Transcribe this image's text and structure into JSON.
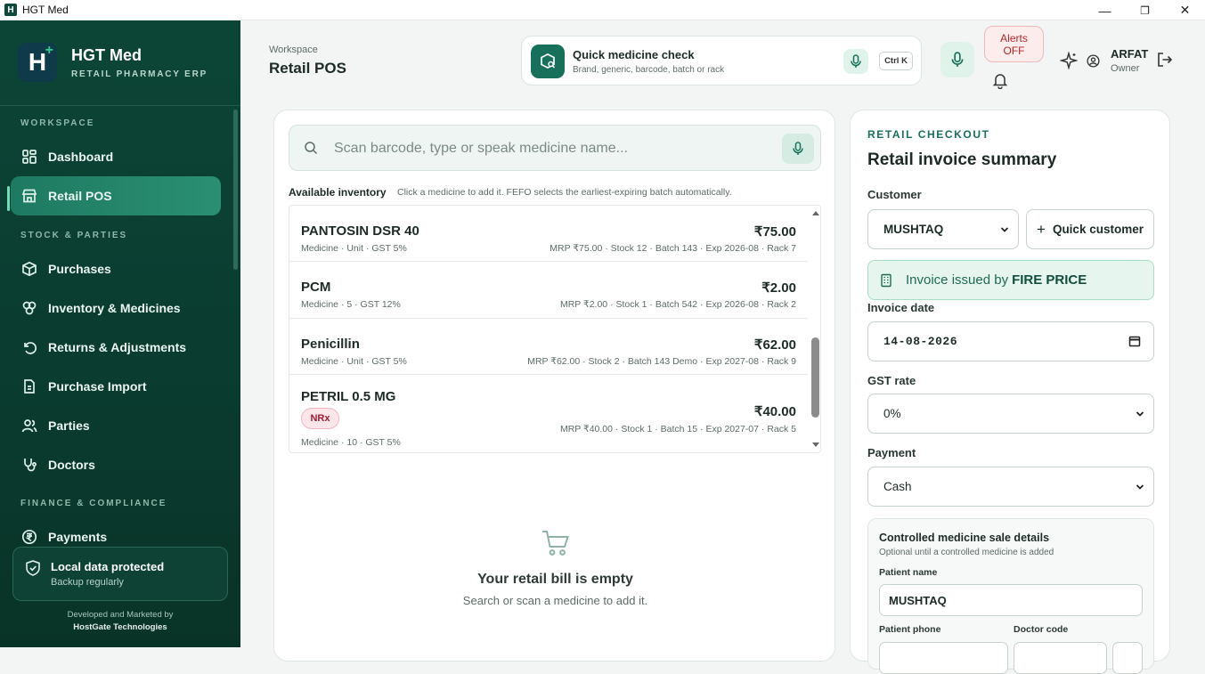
{
  "window": {
    "title": "HGT Med",
    "minimize": "—",
    "maximize": "❐",
    "close": "✕"
  },
  "brand": {
    "logo_letter": "H",
    "logo_plus": "+",
    "name": "HGT Med",
    "subtitle": "RETAIL PHARMACY ERP"
  },
  "sidebar": {
    "sections": {
      "workspace": "WORKSPACE",
      "stock": "STOCK & PARTIES",
      "finance": "FINANCE & COMPLIANCE"
    },
    "items": [
      {
        "label": "Dashboard",
        "icon": "dashboard-icon"
      },
      {
        "label": "Retail POS",
        "icon": "store-icon",
        "active": true
      },
      {
        "label": "Purchases",
        "icon": "box-icon"
      },
      {
        "label": "Inventory & Medicines",
        "icon": "pills-icon"
      },
      {
        "label": "Returns & Adjustments",
        "icon": "undo-icon"
      },
      {
        "label": "Purchase Import",
        "icon": "import-icon"
      },
      {
        "label": "Parties",
        "icon": "users-icon"
      },
      {
        "label": "Doctors",
        "icon": "stethoscope-icon"
      },
      {
        "label": "Payments",
        "icon": "rupee-icon"
      }
    ],
    "protect": {
      "title": "Local data protected",
      "subtitle": "Backup regularly"
    },
    "credit": {
      "line1": "Developed and Marketed by",
      "line2": "HostGate Technologies"
    }
  },
  "header": {
    "workspace_label": "Workspace",
    "workspace_title": "Retail POS",
    "quick_check": {
      "title": "Quick medicine check",
      "subtitle": "Brand, generic, barcode, batch or rack",
      "shortcut": "Ctrl K"
    },
    "alerts": {
      "line1": "Alerts",
      "line2": "OFF"
    },
    "user": {
      "name": "ARFAT",
      "role": "Owner"
    }
  },
  "pos": {
    "search_placeholder": "Scan barcode, type or speak medicine name...",
    "inventory_label": "Available inventory",
    "inventory_hint": "Click a medicine to add it. FEFO selects the earliest-expiring batch automatically.",
    "items": [
      {
        "name": "PANTOSIN DSR 40",
        "meta": "Medicine · Unit · GST 5%",
        "price": "₹75.00",
        "detail": "MRP ₹75.00 · Stock 12 · Batch 143 · Exp 2026-08 · Rack 7",
        "badge": ""
      },
      {
        "name": "PCM",
        "meta": "Medicine · 5 · GST 12%",
        "price": "₹2.00",
        "detail": "MRP ₹2.00 · Stock 1 · Batch 542 · Exp 2026-08 · Rack 2",
        "badge": ""
      },
      {
        "name": "Penicillin",
        "meta": "Medicine · Unit · GST 5%",
        "price": "₹62.00",
        "detail": "MRP ₹62.00 · Stock 2 · Batch 143 Demo · Exp 2027-08 · Rack 9",
        "badge": ""
      },
      {
        "name": "PETRIL 0.5 MG",
        "meta": "Medicine · 10 · GST 5%",
        "price": "₹40.00",
        "detail": "MRP ₹40.00 · Stock 1 · Batch 15 · Exp 2027-07 · Rack 5",
        "badge": "NRx"
      }
    ],
    "empty_title": "Your retail bill is empty",
    "empty_subtitle": "Search or scan a medicine to add it."
  },
  "checkout": {
    "kicker": "RETAIL CHECKOUT",
    "title": "Retail invoice summary",
    "customer_label": "Customer",
    "customer_value": "MUSHTAQ",
    "quick_customer": "Quick customer",
    "issued_prefix": "Invoice issued by",
    "issued_by": "FIRE PRICE",
    "date_label": "Invoice date",
    "date_value": "14-08-2026",
    "gst_label": "GST rate",
    "gst_value": "0%",
    "payment_label": "Payment",
    "payment_value": "Cash",
    "controlled": {
      "title": "Controlled medicine sale details",
      "subtitle": "Optional until a controlled medicine is added",
      "patient_name_label": "Patient name",
      "patient_name_value": "MUSHTAQ",
      "patient_phone_label": "Patient phone",
      "doctor_code_label": "Doctor code"
    }
  }
}
